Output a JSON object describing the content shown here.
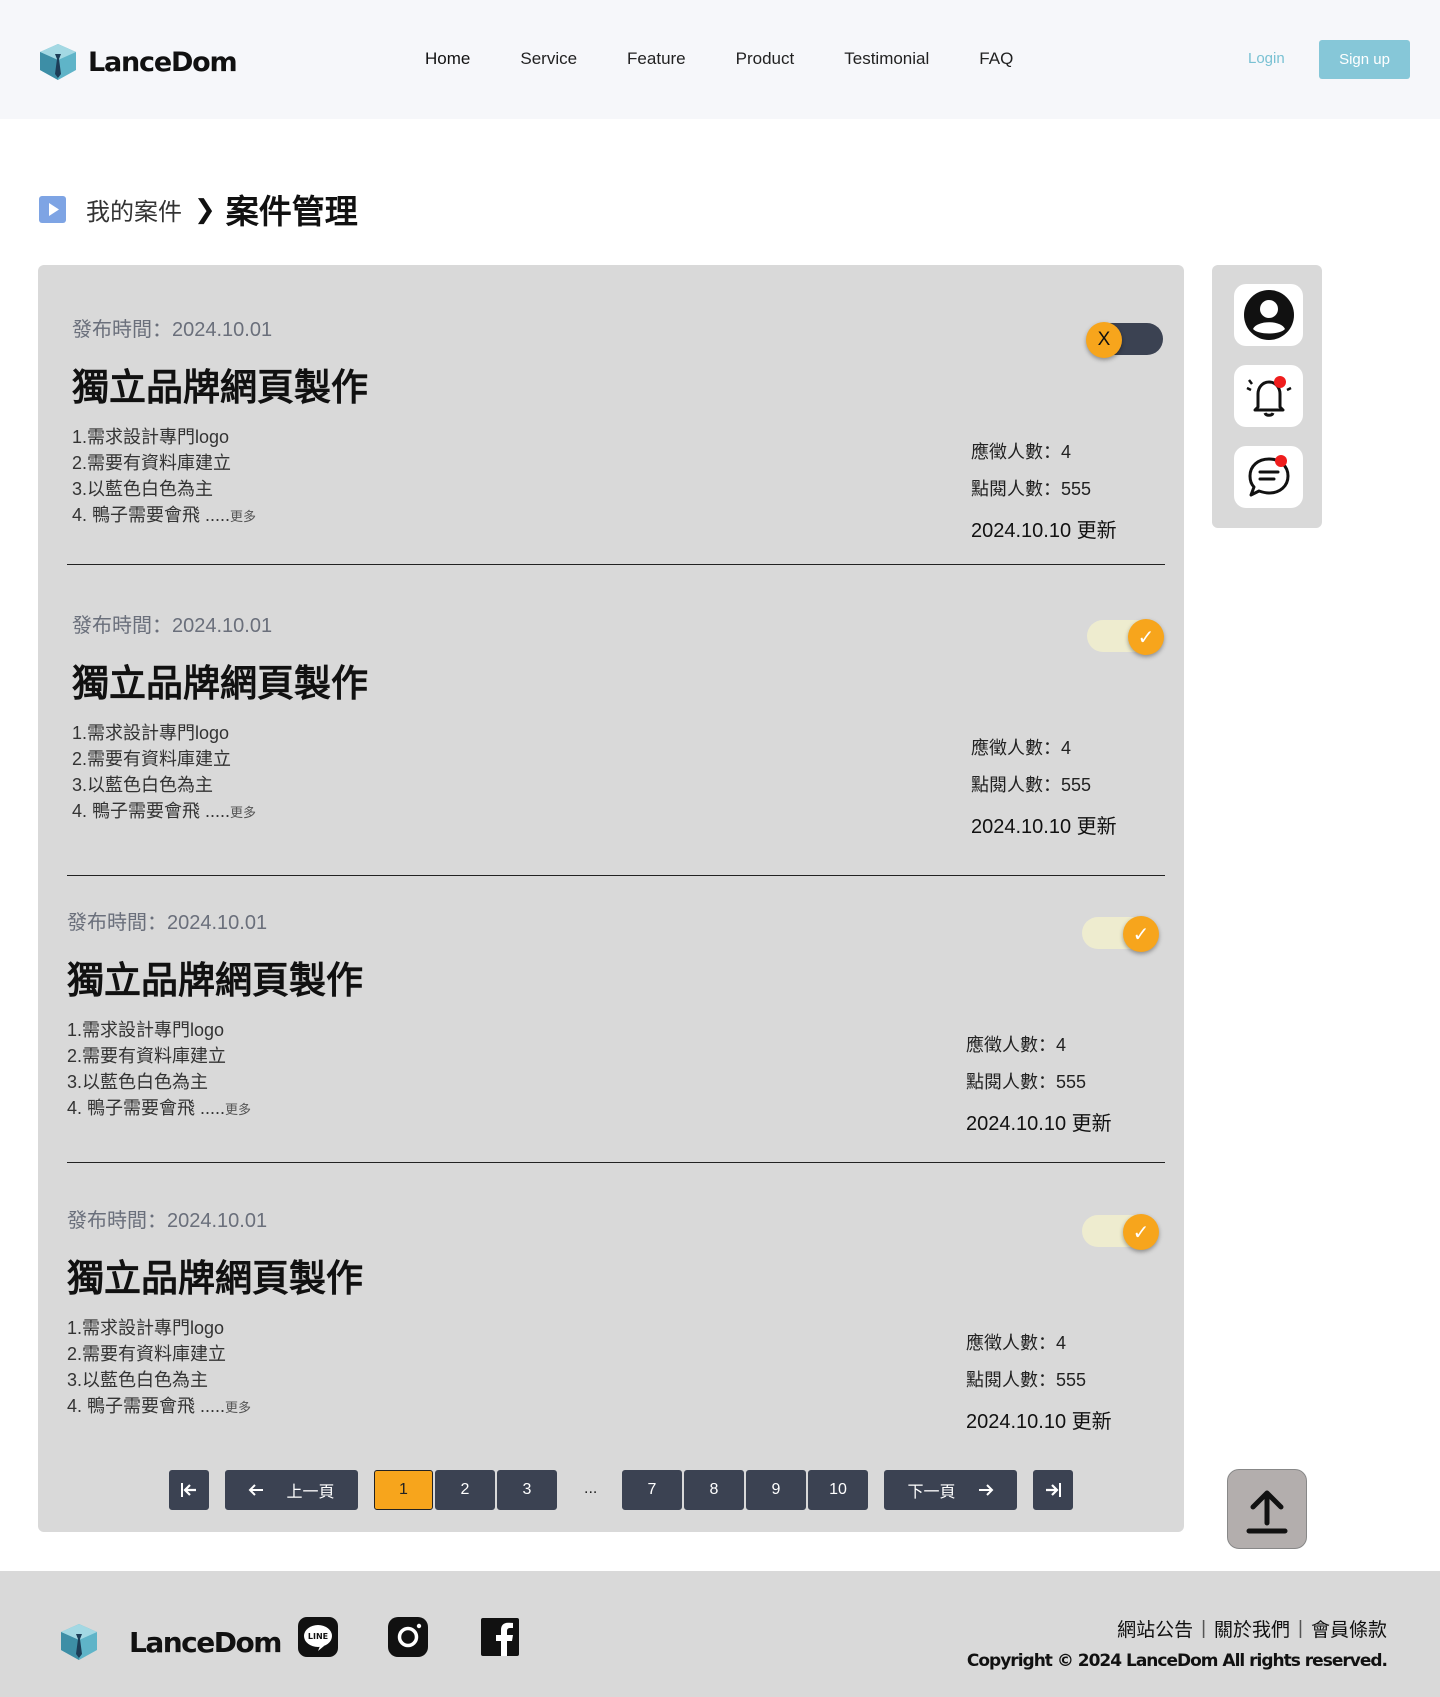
{
  "brand": {
    "name": "LanceDom"
  },
  "nav": {
    "items": [
      "Home",
      "Service",
      "Feature",
      "Product",
      "Testimonial",
      "FAQ"
    ],
    "login": "Login",
    "signup": "Sign up"
  },
  "breadcrumb": {
    "parent": "我的案件",
    "current": "案件管理"
  },
  "cards": [
    {
      "date": "發布時間：2024.10.01",
      "title": "獨立品牌網頁製作",
      "reqs": [
        "1.需求設計專門logo",
        "2.需要有資料庫建立",
        "3.以藍色白色為主",
        "4. 鴨子需要會飛 ....."
      ],
      "more": "更多",
      "applicants": "應徵人數：4",
      "views": "點閱人數：555",
      "updated": "2024.10.10 更新",
      "toggle": "off",
      "toggle_glyph": "X"
    },
    {
      "date": "發布時間：2024.10.01",
      "title": "獨立品牌網頁製作",
      "reqs": [
        "1.需求設計專門logo",
        "2.需要有資料庫建立",
        "3.以藍色白色為主",
        "4. 鴨子需要會飛 ....."
      ],
      "more": "更多",
      "applicants": "應徵人數：4",
      "views": "點閱人數：555",
      "updated": "2024.10.10 更新",
      "toggle": "on",
      "toggle_glyph": "✓"
    },
    {
      "date": "發布時間：2024.10.01",
      "title": "獨立品牌網頁製作",
      "reqs": [
        "1.需求設計專門logo",
        "2.需要有資料庫建立",
        "3.以藍色白色為主",
        "4. 鴨子需要會飛 ....."
      ],
      "more": "更多",
      "applicants": "應徵人數：4",
      "views": "點閱人數：555",
      "updated": "2024.10.10 更新",
      "toggle": "on",
      "toggle_glyph": "✓"
    },
    {
      "date": "發布時間：2024.10.01",
      "title": "獨立品牌網頁製作",
      "reqs": [
        "1.需求設計專門logo",
        "2.需要有資料庫建立",
        "3.以藍色白色為主",
        "4. 鴨子需要會飛 ....."
      ],
      "more": "更多",
      "applicants": "應徵人數：4",
      "views": "點閱人數：555",
      "updated": "2024.10.10 更新",
      "toggle": "on",
      "toggle_glyph": "✓"
    }
  ],
  "pagination": {
    "prev": "上一頁",
    "next": "下一頁",
    "pages_left": [
      "1",
      "2",
      "3"
    ],
    "ellipsis": "...",
    "pages_right": [
      "7",
      "8",
      "9",
      "10"
    ],
    "current": "1"
  },
  "side_icons": [
    "user-icon",
    "bell-icon",
    "chat-icon"
  ],
  "footer": {
    "brand": "LanceDom",
    "links": [
      "網站公告",
      "關於我們",
      "會員條款"
    ],
    "copyright": "Copyright © 2024 LanceDom All rights reserved."
  },
  "colors": {
    "accent": "#f7a51c",
    "brand": "#86c7d8",
    "dark": "#3b4252",
    "panel": "#d9d9d9"
  }
}
